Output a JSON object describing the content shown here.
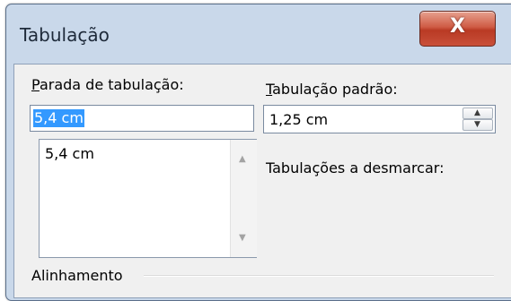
{
  "dialog": {
    "title": "Tabulação",
    "close_glyph": "X"
  },
  "tab_stop": {
    "label_accel": "P",
    "label_rest": "arada de tabulação:",
    "value": "5,4 cm",
    "list_items": [
      "5,4 cm"
    ]
  },
  "default_tab": {
    "label_accel": "T",
    "label_rest": "abulação padrão:",
    "value": "1,25 cm"
  },
  "tabs_to_clear": {
    "label": "Tabulações a desmarcar:"
  },
  "alignment": {
    "label": "Alinhamento"
  },
  "icons": {
    "scroll_up": "scroll-up-arrow",
    "scroll_down": "scroll-down-arrow",
    "spin_up": "spin-up-arrow",
    "spin_down": "spin-down-arrow"
  }
}
